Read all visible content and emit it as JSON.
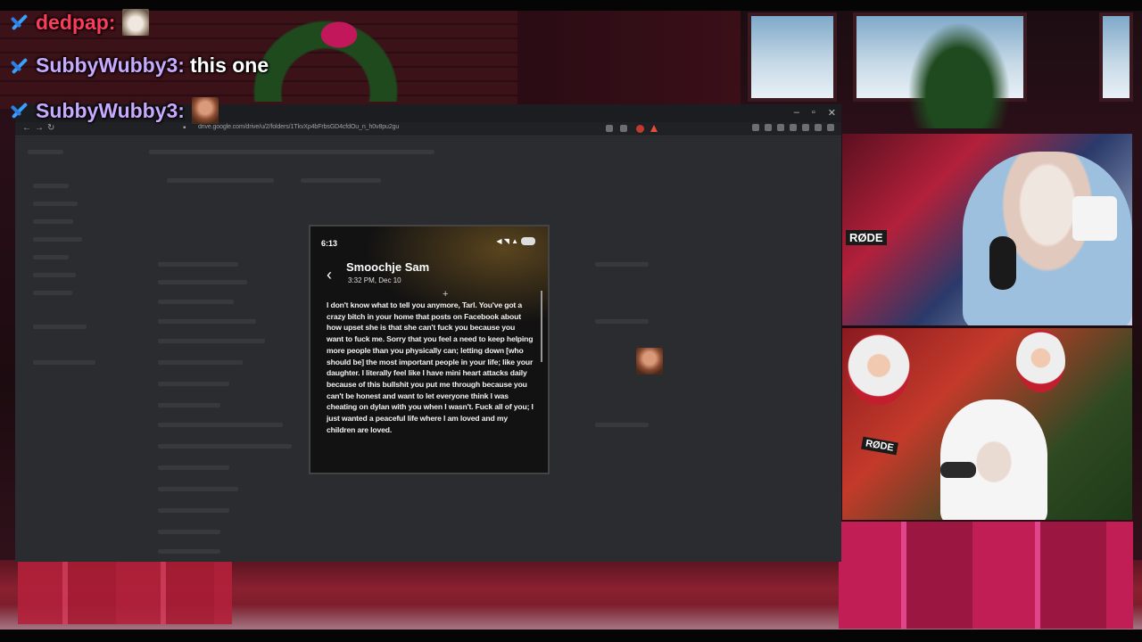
{
  "chat": {
    "messages": [
      {
        "user": "dedpap:",
        "text": "",
        "emote": "cat-emote",
        "color": "#ff3b5c"
      },
      {
        "user": "SubbyWubby3:",
        "text": "this one",
        "emote": "",
        "color": "#c9a9ff"
      },
      {
        "user": "SubbyWubby3:",
        "text": "",
        "emote": "man-face-emote",
        "color": "#c9a9ff"
      }
    ]
  },
  "browser": {
    "url": "drive.google.com/drive/u/2/folders/1TkvXp4bFrbsGD4cfdOu_n_h0v8pu2gu",
    "window_controls": [
      "–",
      "▫",
      "✕"
    ]
  },
  "phone": {
    "status_time": "6:13",
    "status_icons": "◀ ◥ ▲",
    "contact": "Smoochje Sam",
    "timestamp": "3:32 PM, Dec 10",
    "message": "I don't know what to tell you anymore, Tarl. You've got a crazy bitch in your home that posts on Facebook about how upset she is that she can't fuck you because you want to fuck me. Sorry that you feel a need to keep helping more people than you physically can; letting down [who should be] the most important people in your life; like your daughter. I literally feel like I have mini heart attacks daily because of this bullshit you put me through because you can't be honest and want to let everyone think I was cheating on dylan with you when I wasn't. Fuck all of you; I just wanted a peaceful life where I am loved and my children are loved."
  },
  "webcam": {
    "mic_brand": "RØDE"
  }
}
